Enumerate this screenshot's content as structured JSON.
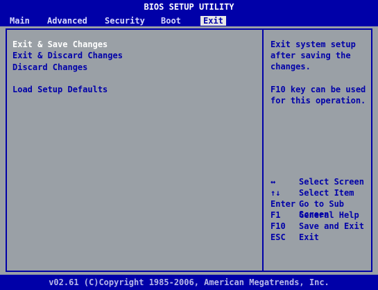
{
  "header": {
    "title": "BIOS SETUP UTILITY"
  },
  "menu": {
    "items": [
      {
        "label": "Main"
      },
      {
        "label": "Advanced"
      },
      {
        "label": "Security"
      },
      {
        "label": "Boot"
      },
      {
        "label": "Exit"
      }
    ],
    "selected": "Exit"
  },
  "options": {
    "items": [
      {
        "label": "Exit & Save Changes",
        "selected": true
      },
      {
        "label": "Exit & Discard Changes"
      },
      {
        "label": "Discard Changes"
      },
      {
        "label": "Load Setup Defaults"
      }
    ]
  },
  "help": {
    "lines": [
      "Exit system setup",
      "after saving the",
      "changes.",
      "F10 key can be used",
      "for this operation."
    ]
  },
  "keys": {
    "items": [
      {
        "key": "↔",
        "action": "Select Screen"
      },
      {
        "key": "↑↓",
        "action": "Select Item"
      },
      {
        "key": "Enter",
        "action": "Go to Sub Screen"
      },
      {
        "key": "F1",
        "action": "General Help"
      },
      {
        "key": "F10",
        "action": "Save and Exit"
      },
      {
        "key": "ESC",
        "action": "Exit"
      }
    ]
  },
  "footer": {
    "text": "v02.61 (C)Copyright 1985-2006, American Megatrends, Inc."
  },
  "colors": {
    "bar": "#0000a8",
    "panel": "#9aa0a6",
    "text": "#0000a8",
    "selected_text": "#ffffff"
  }
}
